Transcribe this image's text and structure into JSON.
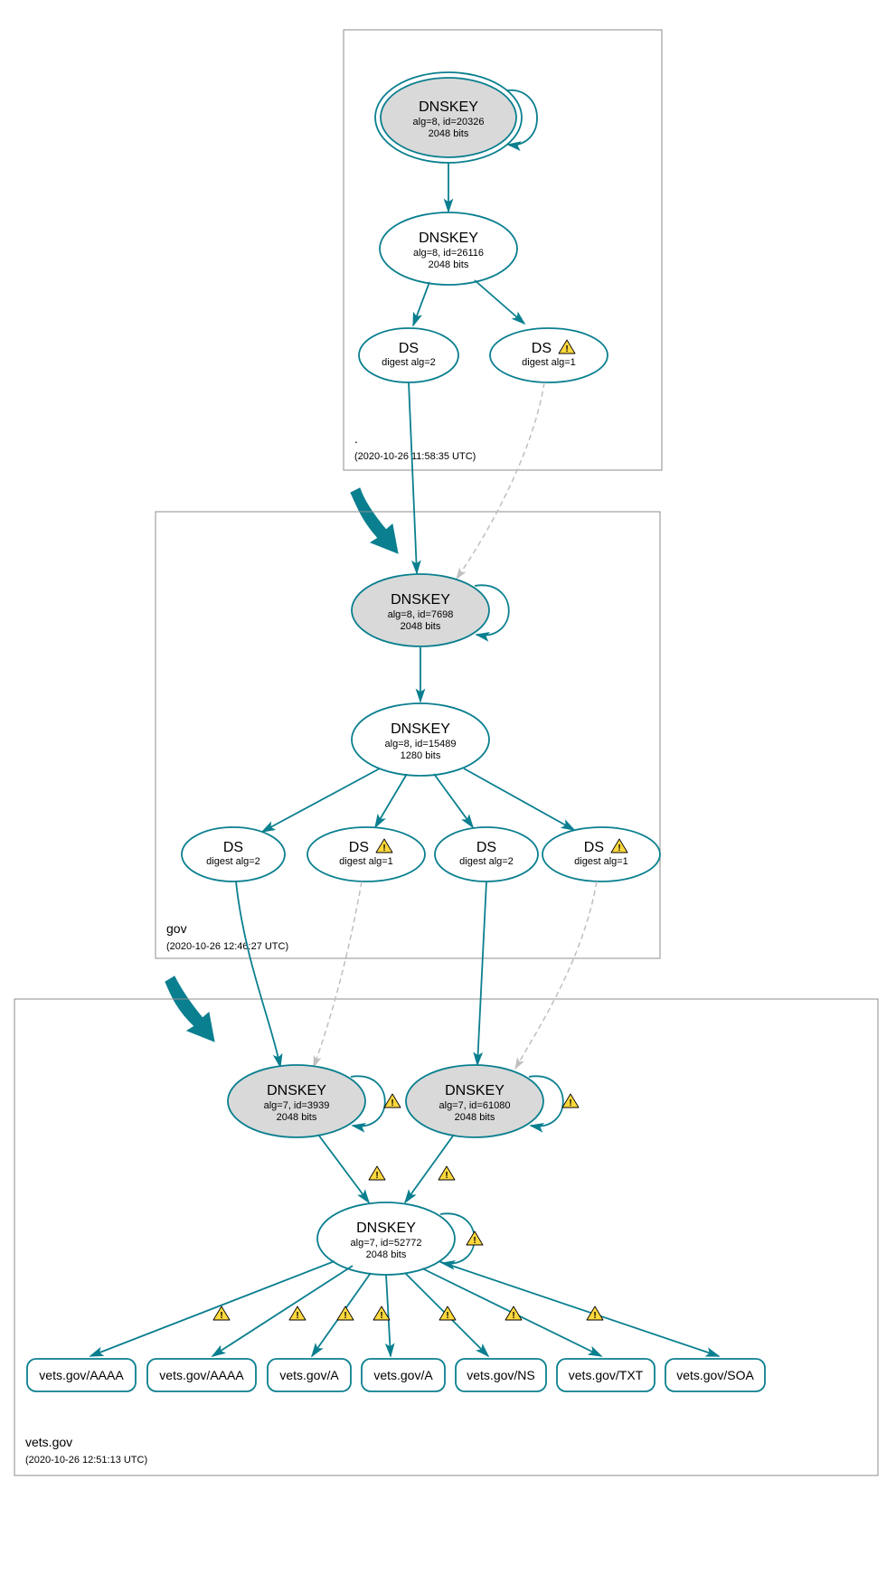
{
  "colors": {
    "accent": "#0a7f8f",
    "node_grey": "#d9d9d9",
    "warn": "#ffd83d",
    "box": "#8c8c8c"
  },
  "zones": {
    "root": {
      "name": ".",
      "timestamp": "(2020-10-26 11:58:35 UTC)"
    },
    "gov": {
      "name": "gov",
      "timestamp": "(2020-10-26 12:46:27 UTC)"
    },
    "vets": {
      "name": "vets.gov",
      "timestamp": "(2020-10-26 12:51:13 UTC)"
    }
  },
  "nodes": {
    "root_ksk": {
      "title": "DNSKEY",
      "line2": "alg=8, id=20326",
      "line3": "2048 bits"
    },
    "root_zsk": {
      "title": "DNSKEY",
      "line2": "alg=8, id=26116",
      "line3": "2048 bits"
    },
    "root_ds1": {
      "title": "DS",
      "line2": "digest alg=2"
    },
    "root_ds2": {
      "title": "DS",
      "line2": "digest alg=1"
    },
    "gov_ksk": {
      "title": "DNSKEY",
      "line2": "alg=8, id=7698",
      "line3": "2048 bits"
    },
    "gov_zsk": {
      "title": "DNSKEY",
      "line2": "alg=8, id=15489",
      "line3": "1280 bits"
    },
    "gov_ds1": {
      "title": "DS",
      "line2": "digest alg=2"
    },
    "gov_ds2": {
      "title": "DS",
      "line2": "digest alg=1"
    },
    "gov_ds3": {
      "title": "DS",
      "line2": "digest alg=2"
    },
    "gov_ds4": {
      "title": "DS",
      "line2": "digest alg=1"
    },
    "vets_ksk1": {
      "title": "DNSKEY",
      "line2": "alg=7, id=3939",
      "line3": "2048 bits"
    },
    "vets_ksk2": {
      "title": "DNSKEY",
      "line2": "alg=7, id=61080",
      "line3": "2048 bits"
    },
    "vets_zsk": {
      "title": "DNSKEY",
      "line2": "alg=7, id=52772",
      "line3": "2048 bits"
    },
    "rr1": {
      "label": "vets.gov/AAAA"
    },
    "rr2": {
      "label": "vets.gov/AAAA"
    },
    "rr3": {
      "label": "vets.gov/A"
    },
    "rr4": {
      "label": "vets.gov/A"
    },
    "rr5": {
      "label": "vets.gov/NS"
    },
    "rr6": {
      "label": "vets.gov/TXT"
    },
    "rr7": {
      "label": "vets.gov/SOA"
    }
  }
}
